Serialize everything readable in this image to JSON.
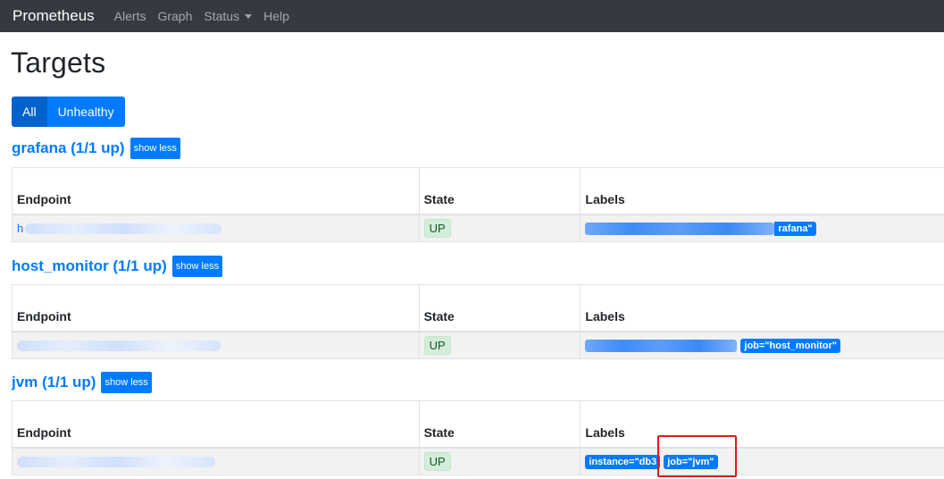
{
  "navbar": {
    "brand": "Prometheus",
    "links": [
      "Alerts",
      "Graph",
      "Status",
      "Help"
    ]
  },
  "page": {
    "title": "Targets",
    "filters": {
      "all": "All",
      "unhealthy": "Unhealthy"
    }
  },
  "table_headers": {
    "endpoint": "Endpoint",
    "state": "State",
    "labels": "Labels"
  },
  "jobs": [
    {
      "title": "grafana (1/1 up)",
      "toggle": "show less",
      "endpoint_prefix": "h",
      "state": "UP",
      "labels": [
        "rafana\""
      ]
    },
    {
      "title": "host_monitor (1/1 up)",
      "toggle": "show less",
      "endpoint_prefix": "",
      "state": "UP",
      "labels": [
        "job=\"host_monitor\""
      ]
    },
    {
      "title": "jvm (1/1 up)",
      "toggle": "show less",
      "endpoint_prefix": "",
      "state": "UP",
      "labels": [
        "instance=\"db3",
        "job=\"jvm\""
      ]
    }
  ],
  "colors": {
    "navbar": "#343a40",
    "primary": "#007bff",
    "primary_active": "#0062cc",
    "state_up_bg": "#d4edda",
    "highlight": "#e01a1a"
  },
  "icons": {
    "status_dropdown": "chevron-down-icon"
  }
}
